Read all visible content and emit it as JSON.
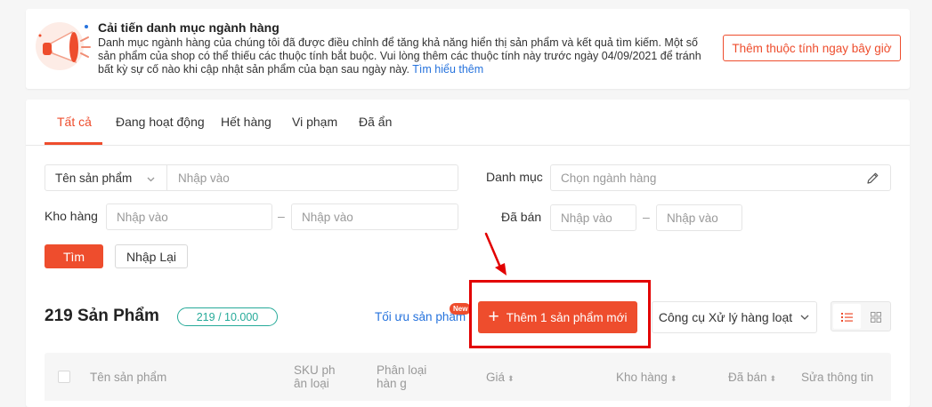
{
  "banner": {
    "title": "Cải tiến danh mục ngành hàng",
    "text": "Danh mục ngành hàng của chúng tôi đã được điều chỉnh để tăng khả năng hiển thị sản phẩm và kết quả tìm kiếm. Một số sản phẩm của shop có thể thiếu các thuộc tính bắt buộc. Vui lòng thêm các thuộc tính này trước ngày 04/09/2021 để tránh bất kỳ sự cố nào khi cập nhật sản phẩm của bạn sau ngày này.",
    "link": "Tìm hiểu thêm",
    "button": "Thêm thuộc tính ngay bây giờ"
  },
  "tabs": [
    "Tất cả",
    "Đang hoạt động",
    "Hết hàng",
    "Vi phạm",
    "Đã ẩn"
  ],
  "filters": {
    "product_name_select": "Tên sản phẩm",
    "product_name_placeholder": "Nhập vào",
    "category_label": "Danh mục",
    "category_placeholder": "Chọn ngành hàng",
    "stock_label": "Kho hàng",
    "stock_min_placeholder": "Nhập vào",
    "stock_max_placeholder": "Nhập vào",
    "sold_label": "Đã bán",
    "sold_min_placeholder": "Nhập vào",
    "sold_max_placeholder": "Nhập vào",
    "range_separator": "–",
    "search_button": "Tìm",
    "reset_button": "Nhập Lại"
  },
  "products": {
    "count_title": "219 Sản Phẩm",
    "quota": "219 / 10.000",
    "optimize_link": "Tối ưu sản phẩm",
    "new_badge": "New",
    "add_button_icon": "+",
    "add_button": "Thêm 1 sản phẩm mới",
    "bulk_tools": "Công cụ Xử lý hàng loạt"
  },
  "table": {
    "headers": {
      "name": "Tên sản phẩm",
      "sku": "SKU ph ân loại",
      "variation": "Phân loại hàn g",
      "price": "Giá",
      "stock": "Kho hàng",
      "sold": "Đã bán",
      "edit": "Sửa thông tin"
    }
  },
  "colors": {
    "accent": "#ee4d2d",
    "link": "#2673dd",
    "quota_teal": "#26aa99",
    "annotation_red": "#e20000"
  },
  "icons": [
    "megaphone-icon",
    "pencil-icon",
    "plus-icon",
    "chevron-down-icon",
    "list-view-icon",
    "grid-view-icon",
    "sort-icon",
    "arrow-annotation-icon"
  ]
}
